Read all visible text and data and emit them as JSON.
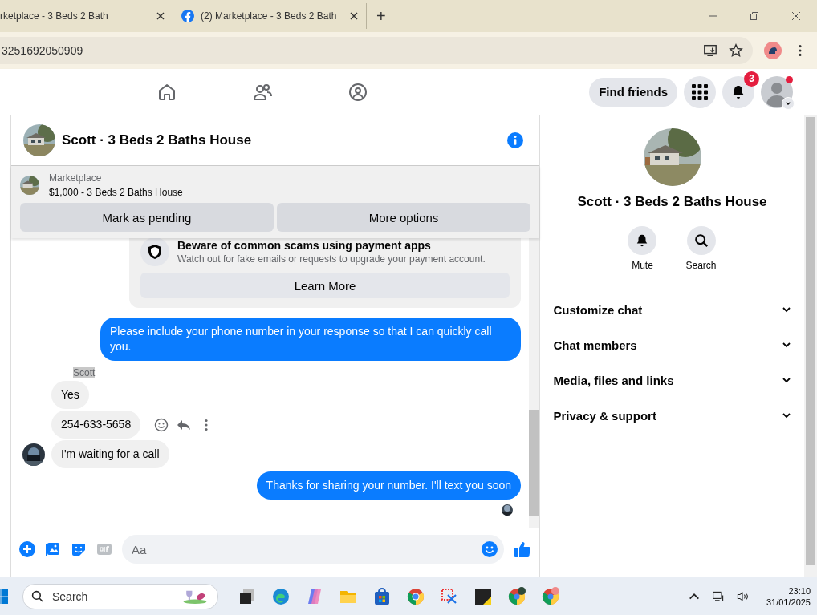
{
  "browser": {
    "tabs": [
      {
        "title": "rketplace - 3 Beds 2 Bath",
        "favicon": false
      },
      {
        "title": "(2) Marketplace - 3 Beds 2 Bath",
        "favicon": true
      }
    ],
    "new_tab": "+",
    "address": "3251692050909"
  },
  "fb_header": {
    "find_friends": "Find friends",
    "notification_count": "3"
  },
  "chat": {
    "title": "Scott · 3 Beds 2 Baths House",
    "listing": {
      "label": "Marketplace",
      "title": "$1,000 - 3 Beds 2 Baths House"
    },
    "listing_buttons": [
      "Mark as pending",
      "More options"
    ],
    "notice": {
      "title": "Beware of common scams using payment apps",
      "text": "Watch out for fake emails or requests to upgrade your payment account.",
      "button": "Learn More"
    },
    "messages": [
      {
        "kind": "sent",
        "text": "Please include your phone number in your response so that I can quickly call you.",
        "seen": false
      },
      {
        "kind": "received",
        "sender": "Scott",
        "text": "Yes",
        "avatar": false,
        "actions": false
      },
      {
        "kind": "received",
        "text": "254-633-5658",
        "avatar": false,
        "actions": true
      },
      {
        "kind": "received",
        "text": "I'm waiting for a call",
        "avatar": true,
        "actions": false
      },
      {
        "kind": "sent",
        "text": "Thanks for sharing your number. I'll text you soon",
        "seen": true
      }
    ],
    "composer": {
      "placeholder": "Aa"
    }
  },
  "details": {
    "name": "Scott · 3 Beds 2 Baths House",
    "actions": [
      {
        "kind": "mute",
        "label": "Mute"
      },
      {
        "kind": "search",
        "label": "Search"
      }
    ],
    "sections": [
      {
        "label": "Customize chat",
        "expanded": false
      },
      {
        "label": "Chat members",
        "expanded": false
      },
      {
        "label": "Media, files and links",
        "expanded": false
      },
      {
        "label": "Privacy & support",
        "expanded": false
      }
    ]
  },
  "taskbar": {
    "search_placeholder": "Search",
    "time": "23:10",
    "date": "31/01/2025"
  }
}
